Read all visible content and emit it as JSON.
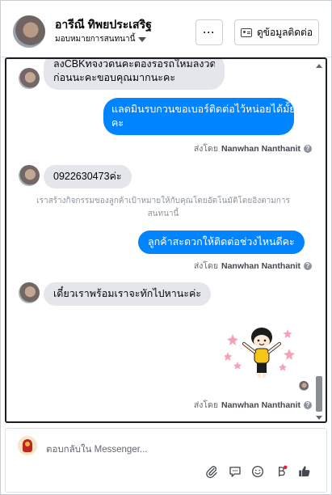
{
  "header": {
    "name": "อารีณี ทิพยประเสริฐ",
    "assign_label": "มอบหมายการสนทนานี้",
    "more_label": "···",
    "contact_button": "ดูข้อมูลติดต่อ"
  },
  "messages": [
    {
      "type": "incoming",
      "text_line1": "ลงCBKทจงวดนคะตองรอรถใหมลงวด",
      "text_line2": "ก่อนนะคะขอบคุณมากนะคะ"
    },
    {
      "type": "outgoing",
      "text_line1": "แลดมินรบกวนขอเบอร์ติดต่อไว้หน่อยได้มั้ย",
      "text_line2": "คะ"
    },
    {
      "type": "sent_by",
      "prefix": "ส่งโดย",
      "name": "Nanwhan Nanthanit"
    },
    {
      "type": "incoming",
      "text": "0922630473ค่ะ"
    },
    {
      "type": "system",
      "text_line1": "เราสร้างกิจกรรมของลูกค้าเป้าหมายให้กับคุณโดยอัตโนมัติโดยอิงตามการ",
      "text_line2": "สนทนานี้"
    },
    {
      "type": "outgoing",
      "text": "ลูกค้าสะดวกให้ติดต่อช่วงไหนดีคะ"
    },
    {
      "type": "sent_by",
      "prefix": "ส่งโดย",
      "name": "Nanwhan Nanthanit"
    },
    {
      "type": "incoming",
      "text": "เดี๋ยวเราพร้อมเราจะทักไปหานะค่ะ"
    },
    {
      "type": "sticker",
      "icon": "waving-girl-sticker"
    },
    {
      "type": "sent_by",
      "prefix": "ส่งโดย",
      "name": "Nanwhan Nanthanit"
    }
  ],
  "composer": {
    "placeholder": "ตอบกลับใน Messenger..."
  },
  "icons": {
    "attach": "paperclip-icon",
    "saved_replies": "speech-bubble-icon",
    "emoji": "smiley-icon",
    "notification": "beta-badge-icon",
    "like": "thumbs-up-icon"
  },
  "colors": {
    "outgoing_bubble": "#0084ff",
    "incoming_bubble": "#e4e6eb",
    "notification_dot": "#e41e3f"
  }
}
